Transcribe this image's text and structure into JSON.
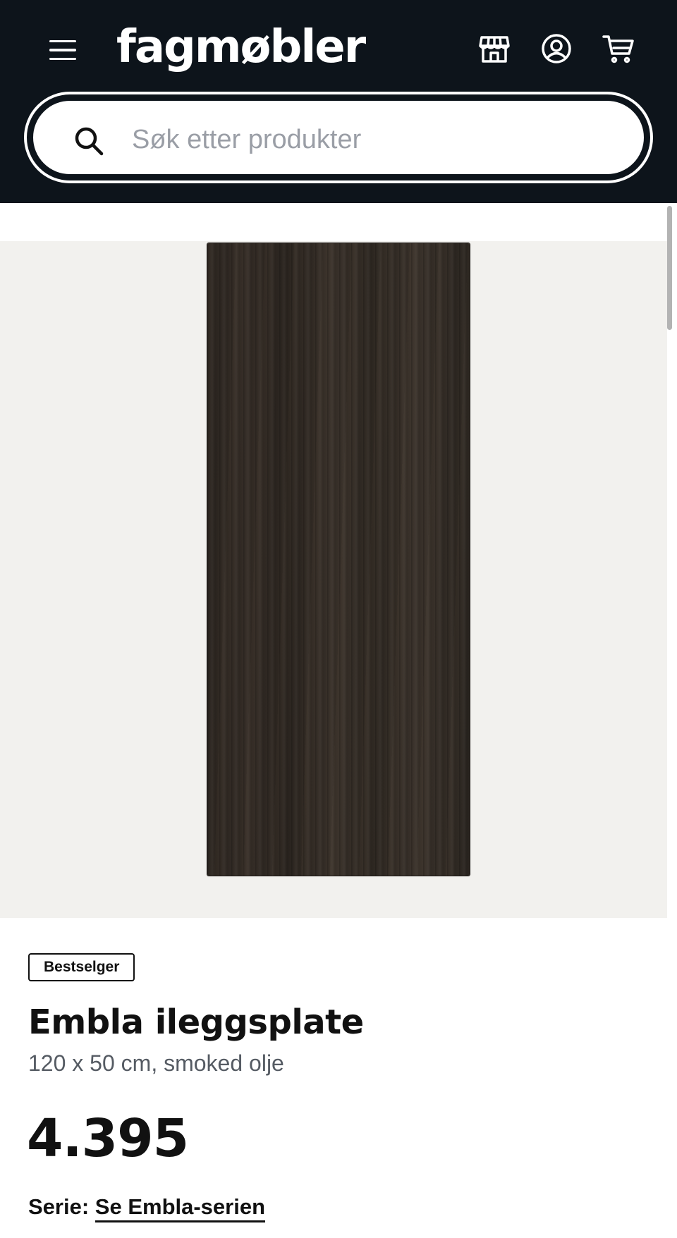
{
  "header": {
    "logo": "fagmøbler",
    "icons": [
      "menu-icon",
      "store-icon",
      "account-icon",
      "cart-icon"
    ]
  },
  "search": {
    "placeholder": "Søk etter produkter"
  },
  "product": {
    "badge": "Bestselger",
    "title": "Embla ileggsplate",
    "subtitle": "120 x 50 cm, smoked olje",
    "price": "4.395",
    "serie_label": "Serie:",
    "serie_link": "Se Embla-serien"
  },
  "colors": {
    "header_bg": "#0d141b",
    "gallery_bg": "#f2f1ee",
    "text": "#111111",
    "subtitle": "#555b63"
  }
}
